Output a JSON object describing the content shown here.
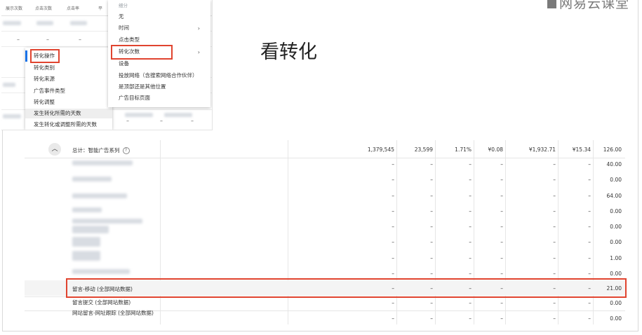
{
  "slide": {
    "title": "看转化",
    "brand": "网易云课堂",
    "brand_icon": "logo-square-icon"
  },
  "screenshot": {
    "column_headers": [
      "展示次数",
      "点击次数",
      "点击率",
      "平"
    ],
    "left_menu": {
      "items": [
        "转化操作",
        "转化类别",
        "转化来源",
        "广告事件类型",
        "转化调整",
        "发生转化所需的天数",
        "发生转化或调整所需的天数"
      ],
      "selected_index": 0,
      "highlighted_index": 5
    },
    "right_menu": {
      "heading": "细分",
      "items": [
        {
          "label": "无",
          "submenu": false
        },
        {
          "label": "时间",
          "submenu": true
        },
        {
          "label": "点击类型",
          "submenu": false
        },
        {
          "label": "转化次数",
          "submenu": true
        },
        {
          "label": "设备",
          "submenu": false
        },
        {
          "label": "投放网络（含搜索网络合作伙伴）",
          "submenu": false
        },
        {
          "label": "是顶部还是其他位置",
          "submenu": false
        },
        {
          "label": "广告目标页面",
          "submenu": false
        }
      ],
      "selected_index": 3
    },
    "dash": "–",
    "accent_color": "#1a73e8",
    "highlight_color": "#e0442f"
  },
  "table": {
    "total_row": {
      "label": "总计：智能广告系列",
      "values": [
        "1,379,545",
        "23,599",
        "1.71%",
        "¥0.08",
        "¥1,932.71",
        "¥15.34",
        "126.00"
      ]
    },
    "rows": [
      {
        "label": "",
        "values": [
          "–",
          "–",
          "–",
          "–",
          "–",
          "–",
          "40.00"
        ]
      },
      {
        "label": "",
        "values": [
          "–",
          "–",
          "–",
          "–",
          "–",
          "–",
          "0.00"
        ]
      },
      {
        "label": "",
        "values": [
          "–",
          "–",
          "–",
          "–",
          "–",
          "–",
          "64.00"
        ]
      },
      {
        "label": "",
        "values": [
          "–",
          "–",
          "–",
          "–",
          "–",
          "–",
          "0.00"
        ]
      },
      {
        "label": "",
        "values": [
          "–",
          "–",
          "–",
          "–",
          "–",
          "–",
          "0.00"
        ]
      },
      {
        "label": "",
        "values": [
          "–",
          "–",
          "–",
          "–",
          "–",
          "–",
          "0.00"
        ]
      },
      {
        "label": "",
        "values": [
          "–",
          "–",
          "–",
          "–",
          "–",
          "–",
          "1.00"
        ]
      },
      {
        "label": "",
        "values": [
          "–",
          "–",
          "–",
          "–",
          "–",
          "–",
          "0.00"
        ]
      },
      {
        "label": "留言-移动 (全部网站数据)",
        "values": [
          "–",
          "–",
          "–",
          "–",
          "–",
          "–",
          "21.00"
        ]
      },
      {
        "label": "留言提交 (全部网站数据)",
        "values": [
          "–",
          "–",
          "–",
          "–",
          "–",
          "–",
          "0.00"
        ]
      },
      {
        "label": "网站留言-网址跟踪 (全部网站数据)",
        "values": [
          "–",
          "–",
          "–",
          "–",
          "–",
          "–",
          "0.00"
        ]
      }
    ],
    "highlighted_row_index": 8
  }
}
